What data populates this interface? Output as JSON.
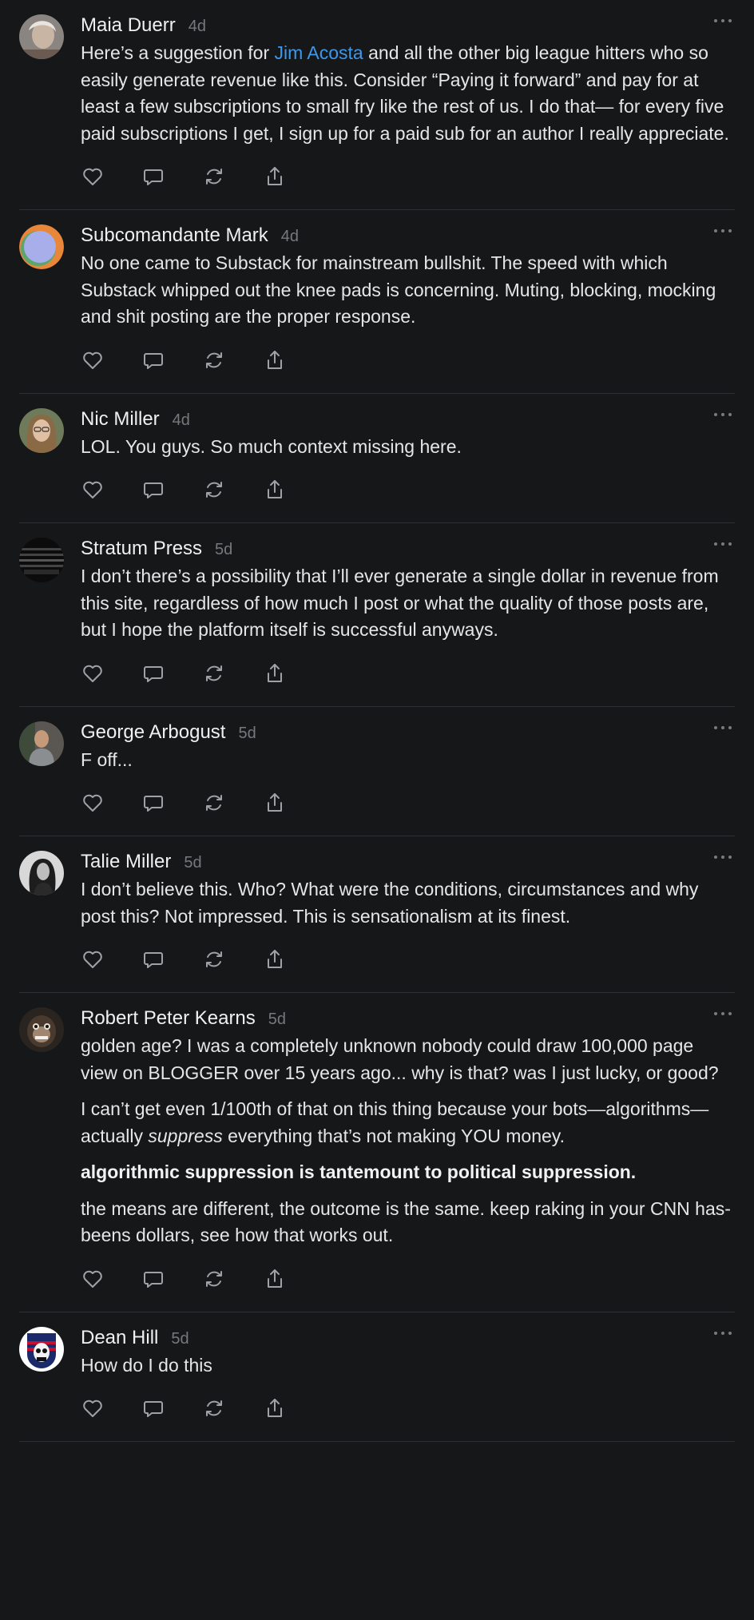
{
  "comments": [
    {
      "author": "Maia Duerr",
      "time": "4d",
      "paragraphs": [
        {
          "before": "Here’s a suggestion for ",
          "link": "Jim Acosta",
          "after": " and all the other big league hitters who so easily generate revenue like this. Consider “Paying it forward” and pay for at least a few subscriptions to small fry like the rest of us. I do that— for every five paid subscriptions I get, I sign up for a paid sub for an author I really appreciate."
        }
      ]
    },
    {
      "author": "Subcomandante Mark",
      "time": "4d",
      "paragraphs": [
        {
          "text": "No one came to Substack for mainstream bullshit. The speed with which Substack whipped out the knee pads is concerning. Muting, blocking, mocking and shit posting are the proper response."
        }
      ]
    },
    {
      "author": "Nic Miller",
      "time": "4d",
      "paragraphs": [
        {
          "text": "LOL. You guys. So much context missing here."
        }
      ]
    },
    {
      "author": "Stratum Press",
      "time": "5d",
      "paragraphs": [
        {
          "text": "I don’t there’s a possibility that I’ll ever generate a single dollar in revenue from this site, regardless of how much I post or what the quality of those posts are, but I hope the platform itself is successful anyways."
        }
      ]
    },
    {
      "author": "George Arbogust",
      "time": "5d",
      "paragraphs": [
        {
          "text": "F off..."
        }
      ]
    },
    {
      "author": "Talie Miller",
      "time": "5d",
      "paragraphs": [
        {
          "text": "I don’t believe this. Who? What were the conditions, circumstances and why post this? Not impressed. This is sensationalism at its finest."
        }
      ]
    },
    {
      "author": "Robert Peter Kearns",
      "time": "5d",
      "paragraphs": [
        {
          "text": "golden age? I was a completely unknown nobody could draw 100,000 page view on BLOGGER over 15 years ago... why is that? was I just lucky, or good?"
        },
        {
          "before": "I can’t get even 1/100th of that on this thing because your bots—algorithms—actually ",
          "em": "suppress",
          "after": " everything that’s not making YOU money."
        },
        {
          "bold": "algorithmic suppression is tantemount to political suppression."
        },
        {
          "text": "the means are different, the outcome is the same. keep raking in your CNN has-beens dollars, see how that works out."
        }
      ]
    },
    {
      "author": "Dean Hill",
      "time": "5d",
      "paragraphs": [
        {
          "text": "How do I do this"
        }
      ]
    }
  ],
  "icons": {
    "like": "heart-icon",
    "reply": "comment-bubble-icon",
    "restack": "restack-icon",
    "share": "share-icon",
    "more": "more-options-icon"
  },
  "colors": {
    "background": "#161719",
    "link": "#3d97ea",
    "muted": "#77787c"
  }
}
